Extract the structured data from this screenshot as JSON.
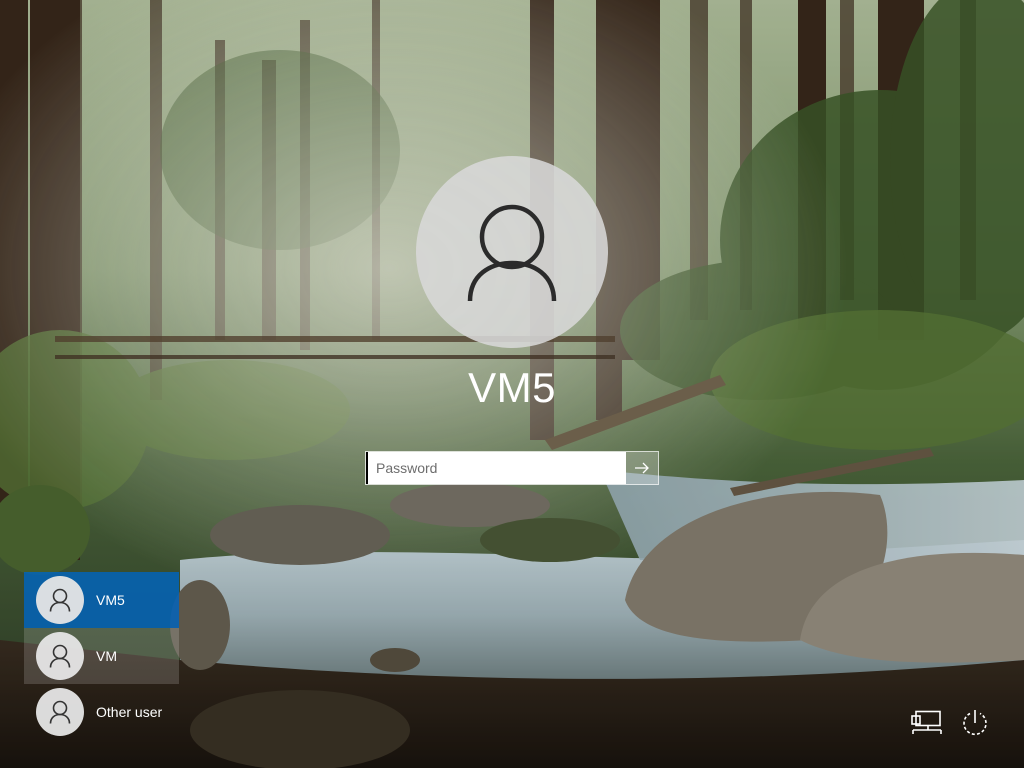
{
  "lock_screen": {
    "user_display_name": "VM5",
    "password_placeholder": "Password",
    "submit_icon": "arrow-right-icon",
    "avatar_icon": "user-icon"
  },
  "user_list": {
    "items": [
      {
        "label": "VM5",
        "selected": true
      },
      {
        "label": "VM",
        "selected": false
      },
      {
        "label": "Other user",
        "selected": false
      }
    ]
  },
  "corner_controls": {
    "network_icon": "network-icon",
    "power_icon": "power-icon"
  },
  "colors": {
    "selected_user": "#0064be",
    "text": "#ffffff"
  }
}
